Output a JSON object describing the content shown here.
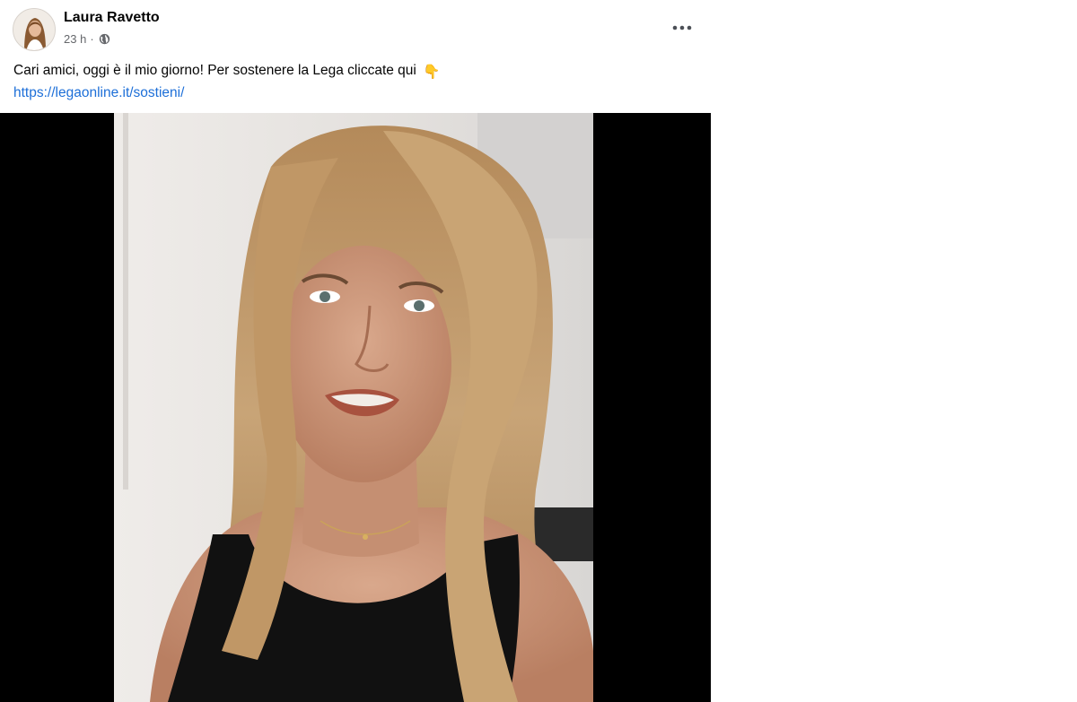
{
  "post": {
    "author": "Laura Ravetto",
    "time": "23 h",
    "separator": "·",
    "audience_icon": "globe-icon",
    "more_icon": "more-options-icon",
    "text": "Cari amici, oggi è il mio giorno! Per sostenere la Lega cliccate qui",
    "emoji": "👇",
    "link": "https://legaonline.it/sostieni/",
    "colors": {
      "link": "#1d6fd8",
      "text": "#050505",
      "meta": "#65676b",
      "video_background": "#000000"
    }
  }
}
